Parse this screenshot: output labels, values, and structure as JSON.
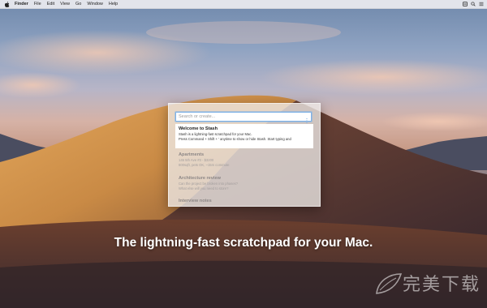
{
  "menubar": {
    "apple_icon": "apple-logo-icon",
    "items": [
      {
        "label": "Finder"
      },
      {
        "label": "File"
      },
      {
        "label": "Edit"
      },
      {
        "label": "View"
      },
      {
        "label": "Go"
      },
      {
        "label": "Window"
      },
      {
        "label": "Help"
      }
    ],
    "right_icons": [
      "stash-menubar-icon",
      "spotlight-search-icon",
      "notification-center-icon"
    ]
  },
  "stash": {
    "search": {
      "placeholder": "Search or create...",
      "value": ""
    },
    "notes": [
      {
        "title": "Welcome to Stash",
        "lines": [
          "Stash is a lightning-fast scratchpad for your Mac.",
          "Press Command + Shift + ' anytime to show or hide Stash. Start typing and"
        ],
        "selected": true
      },
      {
        "title": "Apartments",
        "lines": [
          "145 5th Ave #3 - $3200",
          "800sqft, pets OK, ~15m commute"
        ],
        "selected": false
      },
      {
        "title": "Architecture review",
        "lines": [
          "Can the project be broken into phases?",
          "What else will you need to store?"
        ],
        "selected": false
      },
      {
        "title": "Interview notes",
        "lines": [],
        "selected": false
      }
    ]
  },
  "tagline": "The lightning-fast scratchpad for your Mac.",
  "watermark": {
    "text": "完美下载",
    "logo": "leaf-logo-icon"
  },
  "colors": {
    "search_focus_border": "#7fb2e6",
    "panel_background": "#eeeae8",
    "dim_title": "#8d8786",
    "tagline": "#ffffff"
  }
}
